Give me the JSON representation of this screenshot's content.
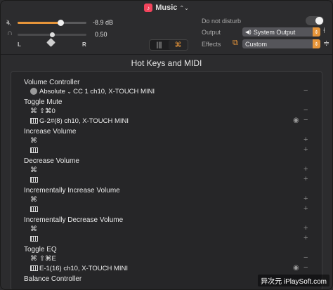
{
  "titlebar": {
    "app_name": "Music",
    "app_icon": "music-note-icon",
    "chevron": "⌃⌄"
  },
  "volume": {
    "speaker_icon": "speaker-mute-icon",
    "level_label": "-8.9 dB",
    "fill_fraction": 0.62
  },
  "balance": {
    "headphone_icon": "headphone-icon",
    "value_label": "0.50",
    "fraction": 0.5,
    "left_label": "L",
    "right_label": "R"
  },
  "mode_switch": {
    "mixer_icon": "mixer-sliders-icon",
    "hotkey_icon": "command-key-icon"
  },
  "right_panel": {
    "dnd_label": "Do not disturb",
    "dnd_on": false,
    "output_label": "Output",
    "output_value": "System Output",
    "effects_label": "Effects",
    "effects_value": "Custom"
  },
  "section_title": "Hot Keys and MIDI",
  "items": [
    {
      "title": "Volume Controller",
      "rows": [
        {
          "kind": "dial",
          "mode": "Absolute",
          "text": "CC 1 ch10, X-TOUCH MINI",
          "action": "−"
        }
      ]
    },
    {
      "title": "Toggle Mute",
      "rows": [
        {
          "kind": "key",
          "text": "⇧⌘0",
          "action": "−"
        },
        {
          "kind": "midi",
          "text": "G-2#(8) ch10, X-TOUCH MINI",
          "action": "−",
          "eye": true
        }
      ]
    },
    {
      "title": "Increase Volume",
      "rows": [
        {
          "kind": "key",
          "text": "",
          "action": "+"
        },
        {
          "kind": "midi",
          "text": "",
          "action": "+"
        }
      ]
    },
    {
      "title": "Decrease Volume",
      "rows": [
        {
          "kind": "key",
          "text": "",
          "action": "+"
        },
        {
          "kind": "midi",
          "text": "",
          "action": "+"
        }
      ]
    },
    {
      "title": "Incrementally Increase Volume",
      "rows": [
        {
          "kind": "key",
          "text": "",
          "action": "+"
        },
        {
          "kind": "midi",
          "text": "",
          "action": "+"
        }
      ]
    },
    {
      "title": "Incrementally Decrease Volume",
      "rows": [
        {
          "kind": "key",
          "text": "",
          "action": "+"
        },
        {
          "kind": "midi",
          "text": "",
          "action": "+"
        }
      ]
    },
    {
      "title": "Toggle EQ",
      "rows": [
        {
          "kind": "key",
          "text": "⇧⌘E",
          "action": "−"
        },
        {
          "kind": "midi",
          "text": "E-1(16) ch10, X-TOUCH MINI",
          "action": "−",
          "eye": true
        }
      ]
    },
    {
      "title": "Balance Controller",
      "rows": []
    }
  ],
  "watermark": "异次元 iPlaySoft.com",
  "colors": {
    "accent": "#e6953a",
    "background": "#2c2c2e",
    "panel": "#262628"
  }
}
